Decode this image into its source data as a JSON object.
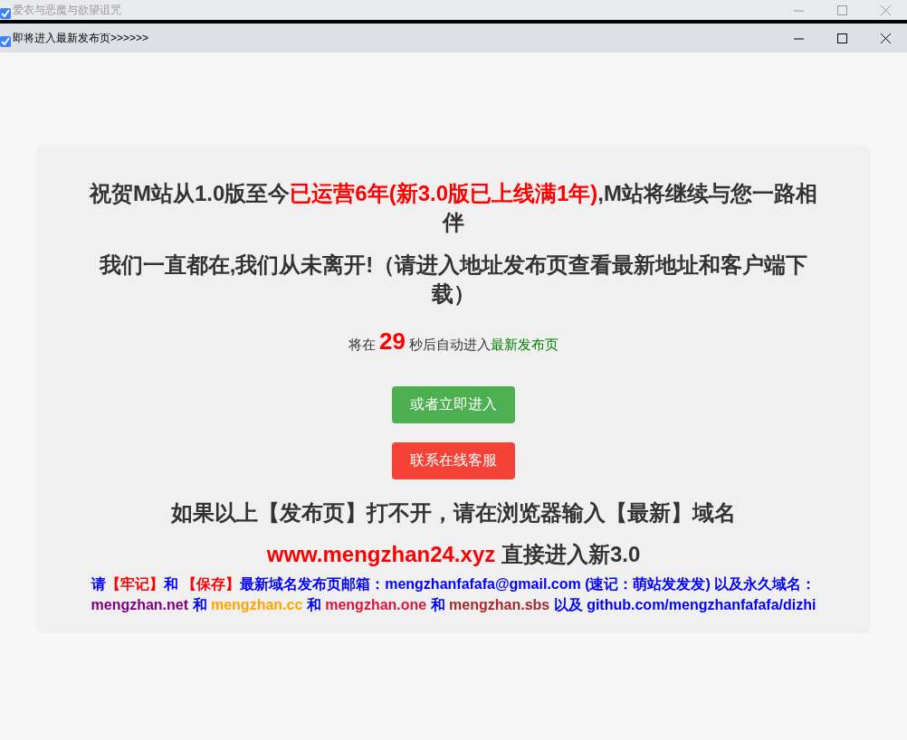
{
  "outer_window": {
    "title": "爱衣与恶魔与欲望诅咒",
    "active": false
  },
  "inner_window": {
    "title": "即将进入最新发布页>>>>>>",
    "active": true
  },
  "notice": {
    "headlines": [
      [
        {
          "text": "祝贺M站从1.0版至今",
          "kind": "plain"
        },
        {
          "text": "已运营6年(新3.0版已上线满1年)",
          "kind": "highlight"
        },
        {
          "text": ",M站将继续与您一路相伴",
          "kind": "plain"
        }
      ],
      [
        {
          "text": "我们一直都在,我们从未离开!（请进入地址发布页查看最新地址和客户端下载）",
          "kind": "plain"
        }
      ]
    ],
    "countdown": {
      "before": "将在",
      "seconds": "29",
      "after": "秒后自动进入",
      "link": "最新发布页"
    },
    "buttons": [
      {
        "label": "或者立即进入",
        "kind": "success"
      },
      {
        "label": "联系在线客服",
        "kind": "danger"
      }
    ],
    "fallback": [
      [
        {
          "text": "如果以上【发布页】打不开，请在浏览器输入【最新】域名",
          "kind": "plain"
        }
      ],
      [
        {
          "text": "www.mengzhan24.xyz",
          "kind": "highlight"
        },
        {
          "text": " 直接进入新3.0",
          "kind": "plain"
        }
      ]
    ],
    "footer": [
      {
        "text": "请",
        "color": "#0000ff"
      },
      {
        "text": "【牢记】",
        "color": "#ff0000"
      },
      {
        "text": "和 ",
        "color": "#0000ff"
      },
      {
        "text": "【保存】",
        "color": "#ff0000"
      },
      {
        "text": "最新域名发布页邮箱：mengzhanfafafa@gmail.com (速记：萌站发发发) 以及永久域名：",
        "color": "#0000ff"
      },
      {
        "text": "mengzhan.net",
        "color": "#800080"
      },
      {
        "text": " 和 ",
        "color": "#0000ff"
      },
      {
        "text": "mengzhan.cc",
        "color": "#ffa500"
      },
      {
        "text": " 和 ",
        "color": "#0000ff"
      },
      {
        "text": "mengzhan.one",
        "color": "#dc143c"
      },
      {
        "text": " 和 ",
        "color": "#0000ff"
      },
      {
        "text": "mengzhan.sbs",
        "color": "#a52a2a"
      },
      {
        "text": " 以及 github.com/mengzhanfafafa/dizhi",
        "color": "#0000ff"
      }
    ]
  }
}
